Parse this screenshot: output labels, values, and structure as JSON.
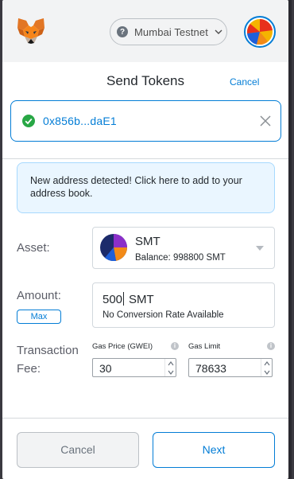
{
  "header": {
    "network_name": "Mumbai Testnet"
  },
  "page": {
    "title": "Send Tokens",
    "cancel_label": "Cancel"
  },
  "recipient": {
    "address": "0x856b...daE1"
  },
  "dialog": {
    "new_address_text": "New address detected! Click here to add to your address book."
  },
  "asset": {
    "label": "Asset:",
    "symbol": "SMT",
    "balance": "Balance: 998800 SMT"
  },
  "amount": {
    "label": "Amount:",
    "max_label": "Max",
    "value": "500",
    "unit": "SMT",
    "conversion": "No Conversion Rate Available"
  },
  "fee": {
    "label_line1": "Transaction",
    "label_line2": "Fee:",
    "gas_price_label": "Gas Price (GWEI)",
    "gas_price_value": "30",
    "gas_limit_label": "Gas Limit",
    "gas_limit_value": "78633"
  },
  "footer": {
    "cancel_label": "Cancel",
    "next_label": "Next"
  },
  "colors": {
    "accent": "#037dd6",
    "success": "#28a745",
    "dialog_bg": "#eaf6ff"
  },
  "icons": [
    "metamask-fox-icon",
    "question-icon",
    "chevron-down-icon",
    "check-circle-icon",
    "close-icon",
    "caret-down-icon",
    "info-icon",
    "spinner-up-icon",
    "spinner-down-icon"
  ]
}
